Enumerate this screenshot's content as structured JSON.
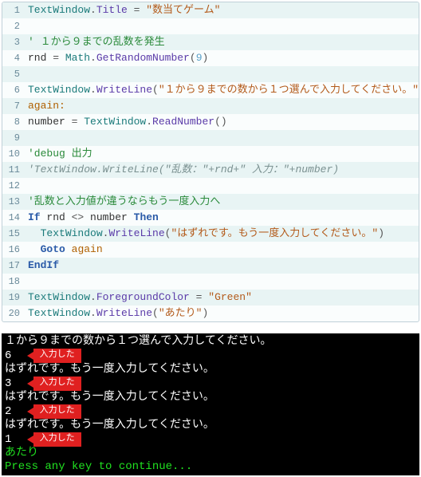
{
  "editor": {
    "lines": [
      {
        "n": 1,
        "hl": true,
        "t": [
          [
            "obj",
            "TextWindow"
          ],
          [
            "dot",
            "."
          ],
          [
            "mem",
            "Title"
          ],
          [
            "op",
            " = "
          ],
          [
            "str",
            "\"数当てゲーム\""
          ]
        ]
      },
      {
        "n": 2,
        "hl": false,
        "t": []
      },
      {
        "n": 3,
        "hl": true,
        "t": [
          [
            "com",
            "' １から９までの乱数を発生"
          ]
        ]
      },
      {
        "n": 4,
        "hl": false,
        "t": [
          [
            "var",
            "rnd"
          ],
          [
            "op",
            " = "
          ],
          [
            "obj",
            "Math"
          ],
          [
            "dot",
            "."
          ],
          [
            "mem",
            "GetRandomNumber"
          ],
          [
            "op",
            "("
          ],
          [
            "num",
            "9"
          ],
          [
            "op",
            ")"
          ]
        ]
      },
      {
        "n": 5,
        "hl": true,
        "t": []
      },
      {
        "n": 6,
        "hl": false,
        "t": [
          [
            "obj",
            "TextWindow"
          ],
          [
            "dot",
            "."
          ],
          [
            "mem",
            "WriteLine"
          ],
          [
            "op",
            "("
          ],
          [
            "str",
            "\"１から９までの数から１つ選んで入力してください。\""
          ],
          [
            "op",
            ")"
          ]
        ]
      },
      {
        "n": 7,
        "hl": true,
        "t": [
          [
            "lbl",
            "again:"
          ]
        ]
      },
      {
        "n": 8,
        "hl": false,
        "t": [
          [
            "var",
            "number"
          ],
          [
            "op",
            " = "
          ],
          [
            "obj",
            "TextWindow"
          ],
          [
            "dot",
            "."
          ],
          [
            "mem",
            "ReadNumber"
          ],
          [
            "op",
            "()"
          ]
        ]
      },
      {
        "n": 9,
        "hl": true,
        "t": []
      },
      {
        "n": 10,
        "hl": false,
        "t": [
          [
            "com",
            "'debug 出力"
          ]
        ]
      },
      {
        "n": 11,
        "hl": true,
        "t": [
          [
            "dim",
            "'TextWindow.WriteLine(\"乱数：\"+rnd+\" 入力：\"+number)"
          ]
        ]
      },
      {
        "n": 12,
        "hl": false,
        "t": []
      },
      {
        "n": 13,
        "hl": true,
        "t": [
          [
            "com",
            "'乱数と入力値が違うならもう一度入力へ"
          ]
        ]
      },
      {
        "n": 14,
        "hl": false,
        "t": [
          [
            "kw",
            "If"
          ],
          [
            "var",
            " rnd "
          ],
          [
            "op",
            "<>"
          ],
          [
            "var",
            " number "
          ],
          [
            "kw",
            "Then"
          ]
        ]
      },
      {
        "n": 15,
        "hl": true,
        "t": [
          [
            "var",
            "  "
          ],
          [
            "obj",
            "TextWindow"
          ],
          [
            "dot",
            "."
          ],
          [
            "mem",
            "WriteLine"
          ],
          [
            "op",
            "("
          ],
          [
            "str",
            "\"はずれです。もう一度入力してください。\""
          ],
          [
            "op",
            ")"
          ]
        ]
      },
      {
        "n": 16,
        "hl": false,
        "t": [
          [
            "var",
            "  "
          ],
          [
            "kw",
            "Goto"
          ],
          [
            "var",
            " "
          ],
          [
            "lbl",
            "again"
          ]
        ]
      },
      {
        "n": 17,
        "hl": true,
        "t": [
          [
            "kw",
            "EndIf"
          ]
        ]
      },
      {
        "n": 18,
        "hl": false,
        "t": []
      },
      {
        "n": 19,
        "hl": true,
        "t": [
          [
            "obj",
            "TextWindow"
          ],
          [
            "dot",
            "."
          ],
          [
            "mem",
            "ForegroundColor"
          ],
          [
            "op",
            " = "
          ],
          [
            "str",
            "\"Green\""
          ]
        ]
      },
      {
        "n": 20,
        "hl": false,
        "t": [
          [
            "obj",
            "TextWindow"
          ],
          [
            "dot",
            "."
          ],
          [
            "mem",
            "WriteLine"
          ],
          [
            "op",
            "("
          ],
          [
            "str",
            "\"あたり\""
          ],
          [
            "op",
            ")"
          ]
        ]
      }
    ]
  },
  "terminal": {
    "badge_text": "入力した",
    "rows": [
      {
        "kind": "out",
        "text": "１から９までの数から１つ選んで入力してください。"
      },
      {
        "kind": "in",
        "text": "6"
      },
      {
        "kind": "out",
        "text": "はずれです。もう一度入力してください。"
      },
      {
        "kind": "in",
        "text": "3"
      },
      {
        "kind": "out",
        "text": "はずれです。もう一度入力してください。"
      },
      {
        "kind": "in",
        "text": "2"
      },
      {
        "kind": "out",
        "text": "はずれです。もう一度入力してください。"
      },
      {
        "kind": "in",
        "text": "1"
      },
      {
        "kind": "green",
        "text": "あたり"
      },
      {
        "kind": "green",
        "text": "Press any key to continue..."
      }
    ]
  }
}
